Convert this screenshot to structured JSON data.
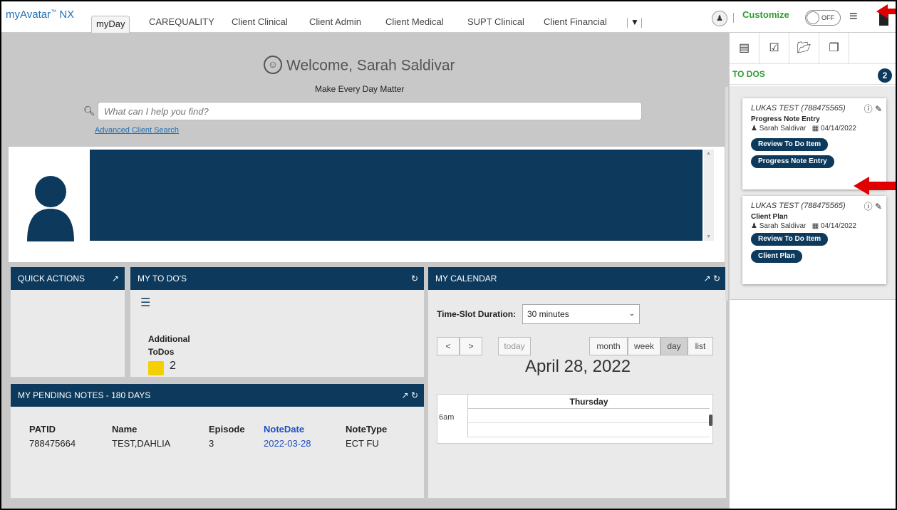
{
  "app": {
    "logo": "myAvatar",
    "logo_tm": "™",
    "logo_suffix": "NX"
  },
  "nav": {
    "tabs": [
      "myDay",
      "CAREQUALITY",
      "Client Clinical",
      "Client Admin",
      "Client Medical",
      "SUPT Clinical",
      "Client Financial"
    ],
    "active_tab": "myDay",
    "customize_label": "Customize",
    "toggle_state": "OFF"
  },
  "welcome": {
    "title": "Welcome, Sarah Saldivar",
    "subtitle": "Make Every Day Matter",
    "search_placeholder": "What can I help you find?",
    "advanced_search": "Advanced Client Search"
  },
  "widgets": {
    "quick_actions": {
      "title": "QUICK ACTIONS"
    },
    "my_todos": {
      "title": "MY TO DO'S",
      "additional_label_1": "Additional",
      "additional_label_2": "ToDos",
      "additional_count": "2"
    },
    "calendar": {
      "title": "MY CALENDAR",
      "duration_label": "Time-Slot Duration:",
      "duration_value": "30 minutes",
      "today": "today",
      "views": [
        "month",
        "week",
        "day",
        "list"
      ],
      "active_view": "day",
      "date_title": "April 28, 2022",
      "day_header": "Thursday",
      "time_label": "6am"
    },
    "pending_notes": {
      "title": "MY PENDING NOTES - 180 DAYS",
      "columns": [
        "PATID",
        "Name",
        "Episode",
        "NoteDate",
        "NoteType"
      ],
      "rows": [
        [
          "788475664",
          "TEST,DAHLIA",
          "3",
          "2022-03-28",
          "ECT FU"
        ]
      ]
    }
  },
  "right_panel": {
    "title": "TO DOS",
    "count": "2",
    "cards": [
      {
        "client": "LUKAS TEST (788475565)",
        "type": "Progress Note Entry",
        "user": "Sarah Saldivar",
        "date": "04/14/2022",
        "buttons": [
          "Review To Do Item",
          "Progress Note Entry"
        ]
      },
      {
        "client": "LUKAS TEST (788475565)",
        "type": "Client Plan",
        "user": "Sarah Saldivar",
        "date": "04/14/2022",
        "buttons": [
          "Review To Do Item",
          "Client Plan"
        ]
      }
    ]
  },
  "colors": {
    "navy": "#0d3a5c",
    "green": "#2e9e2e",
    "link_blue": "#1f6fb5",
    "annotation_red": "#e00000"
  },
  "icons": [
    "user-icon",
    "hamburger-menu-icon",
    "search-icon",
    "external-link-icon",
    "refresh-icon",
    "list-icon",
    "folder-icon",
    "info-icon",
    "edit-icon",
    "calendar-icon",
    "person-icon"
  ]
}
